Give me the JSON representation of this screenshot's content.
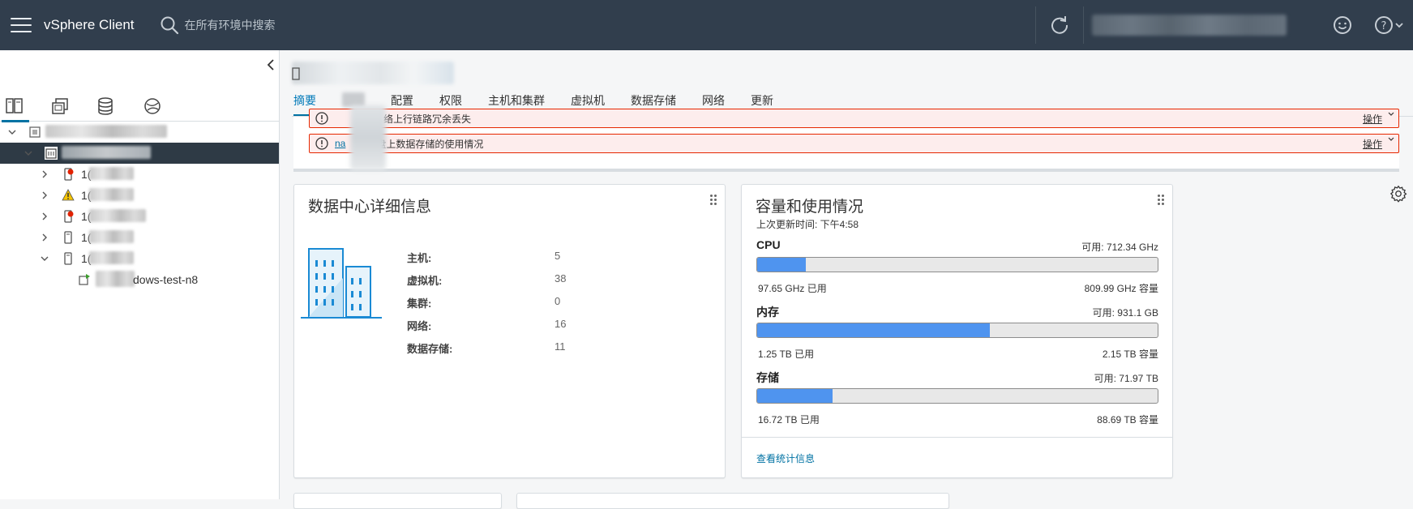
{
  "header": {
    "app_title": "vSphere Client",
    "search_placeholder": "在所有环境中搜索"
  },
  "tree": {
    "vm_label_suffix": "dows-test-n8",
    "host_prefix": "1("
  },
  "tabs": [
    "摘要",
    "配置",
    "权限",
    "主机和集群",
    "虚拟机",
    "数据存储",
    "网络",
    "更新"
  ],
  "alerts": [
    {
      "name": "",
      "text": "络上行链路冗余丢失",
      "action": "操作"
    },
    {
      "name": "na",
      "text": "盘上数据存储的使用情况",
      "action": "操作"
    }
  ],
  "datacenter_card": {
    "title": "数据中心详细信息",
    "rows": [
      {
        "label": "主机:",
        "value": "5"
      },
      {
        "label": "虚拟机:",
        "value": "38"
      },
      {
        "label": "集群:",
        "value": "0"
      },
      {
        "label": "网络:",
        "value": "16"
      },
      {
        "label": "数据存储:",
        "value": "11"
      }
    ]
  },
  "capacity_card": {
    "title": "容量和使用情况",
    "updated": "上次更新时间: 下午4:58",
    "resources": [
      {
        "name": "CPU",
        "available": "可用: 712.34 GHz",
        "used": "97.65 GHz 已用",
        "total": "809.99 GHz 容量",
        "fraction": 0.121
      },
      {
        "name": "内存",
        "available": "可用: 931.1 GB",
        "used": "1.25 TB 已用",
        "total": "2.15 TB 容量",
        "fraction": 0.581
      },
      {
        "name": "存储",
        "available": "可用: 71.97 TB",
        "used": "16.72 TB 已用",
        "total": "88.69 TB 容量",
        "fraction": 0.189
      }
    ],
    "link": "查看统计信息"
  },
  "colors": {
    "header_bg": "#313e4d",
    "accent": "#0072a3",
    "bar_fill": "#4f94ef",
    "alert_border": "#e62700"
  }
}
